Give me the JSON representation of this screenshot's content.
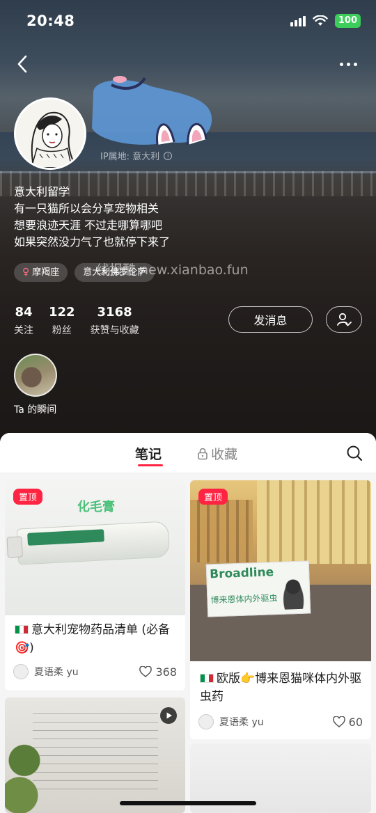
{
  "status_bar": {
    "time": "20:48",
    "battery": "100"
  },
  "profile": {
    "ip_location": "IP属地: 意大利",
    "bio": [
      "意大利留学",
      "有一只猫所以会分享宠物相关",
      "想要浪迹天涯 不过走哪算哪吧",
      "如果突然没力气了也就停下来了"
    ],
    "tags": [
      "摩羯座",
      "意大利佛罗伦萨"
    ],
    "watermark": "线报酷 new.xianbao.fun",
    "stats": [
      {
        "num": "84",
        "label": "关注"
      },
      {
        "num": "122",
        "label": "粉丝"
      },
      {
        "num": "3168",
        "label": "获赞与收藏"
      }
    ],
    "message_button": "发消息",
    "moments_label": "Ta 的瞬间"
  },
  "tabs": {
    "notes": "笔记",
    "favorites": "收藏"
  },
  "cards": [
    {
      "pinned": "置顶",
      "image_text": "化毛膏",
      "title": "意大利宠物药品清单 (必备🎯)",
      "author": "夏语柔 yu",
      "likes": "368"
    },
    {
      "pinned": "置顶",
      "image_brand": "Broadline",
      "image_sub": "博来恩体内外驱虫",
      "title": "欧版👉博来恩猫咪体内外驱虫药",
      "author": "夏语柔 yu",
      "likes": "60"
    },
    {
      "video": true
    },
    {}
  ],
  "colors": {
    "accent": "#ff2442",
    "battery": "#3ccd5a",
    "brand_green": "#2e8a5a"
  }
}
